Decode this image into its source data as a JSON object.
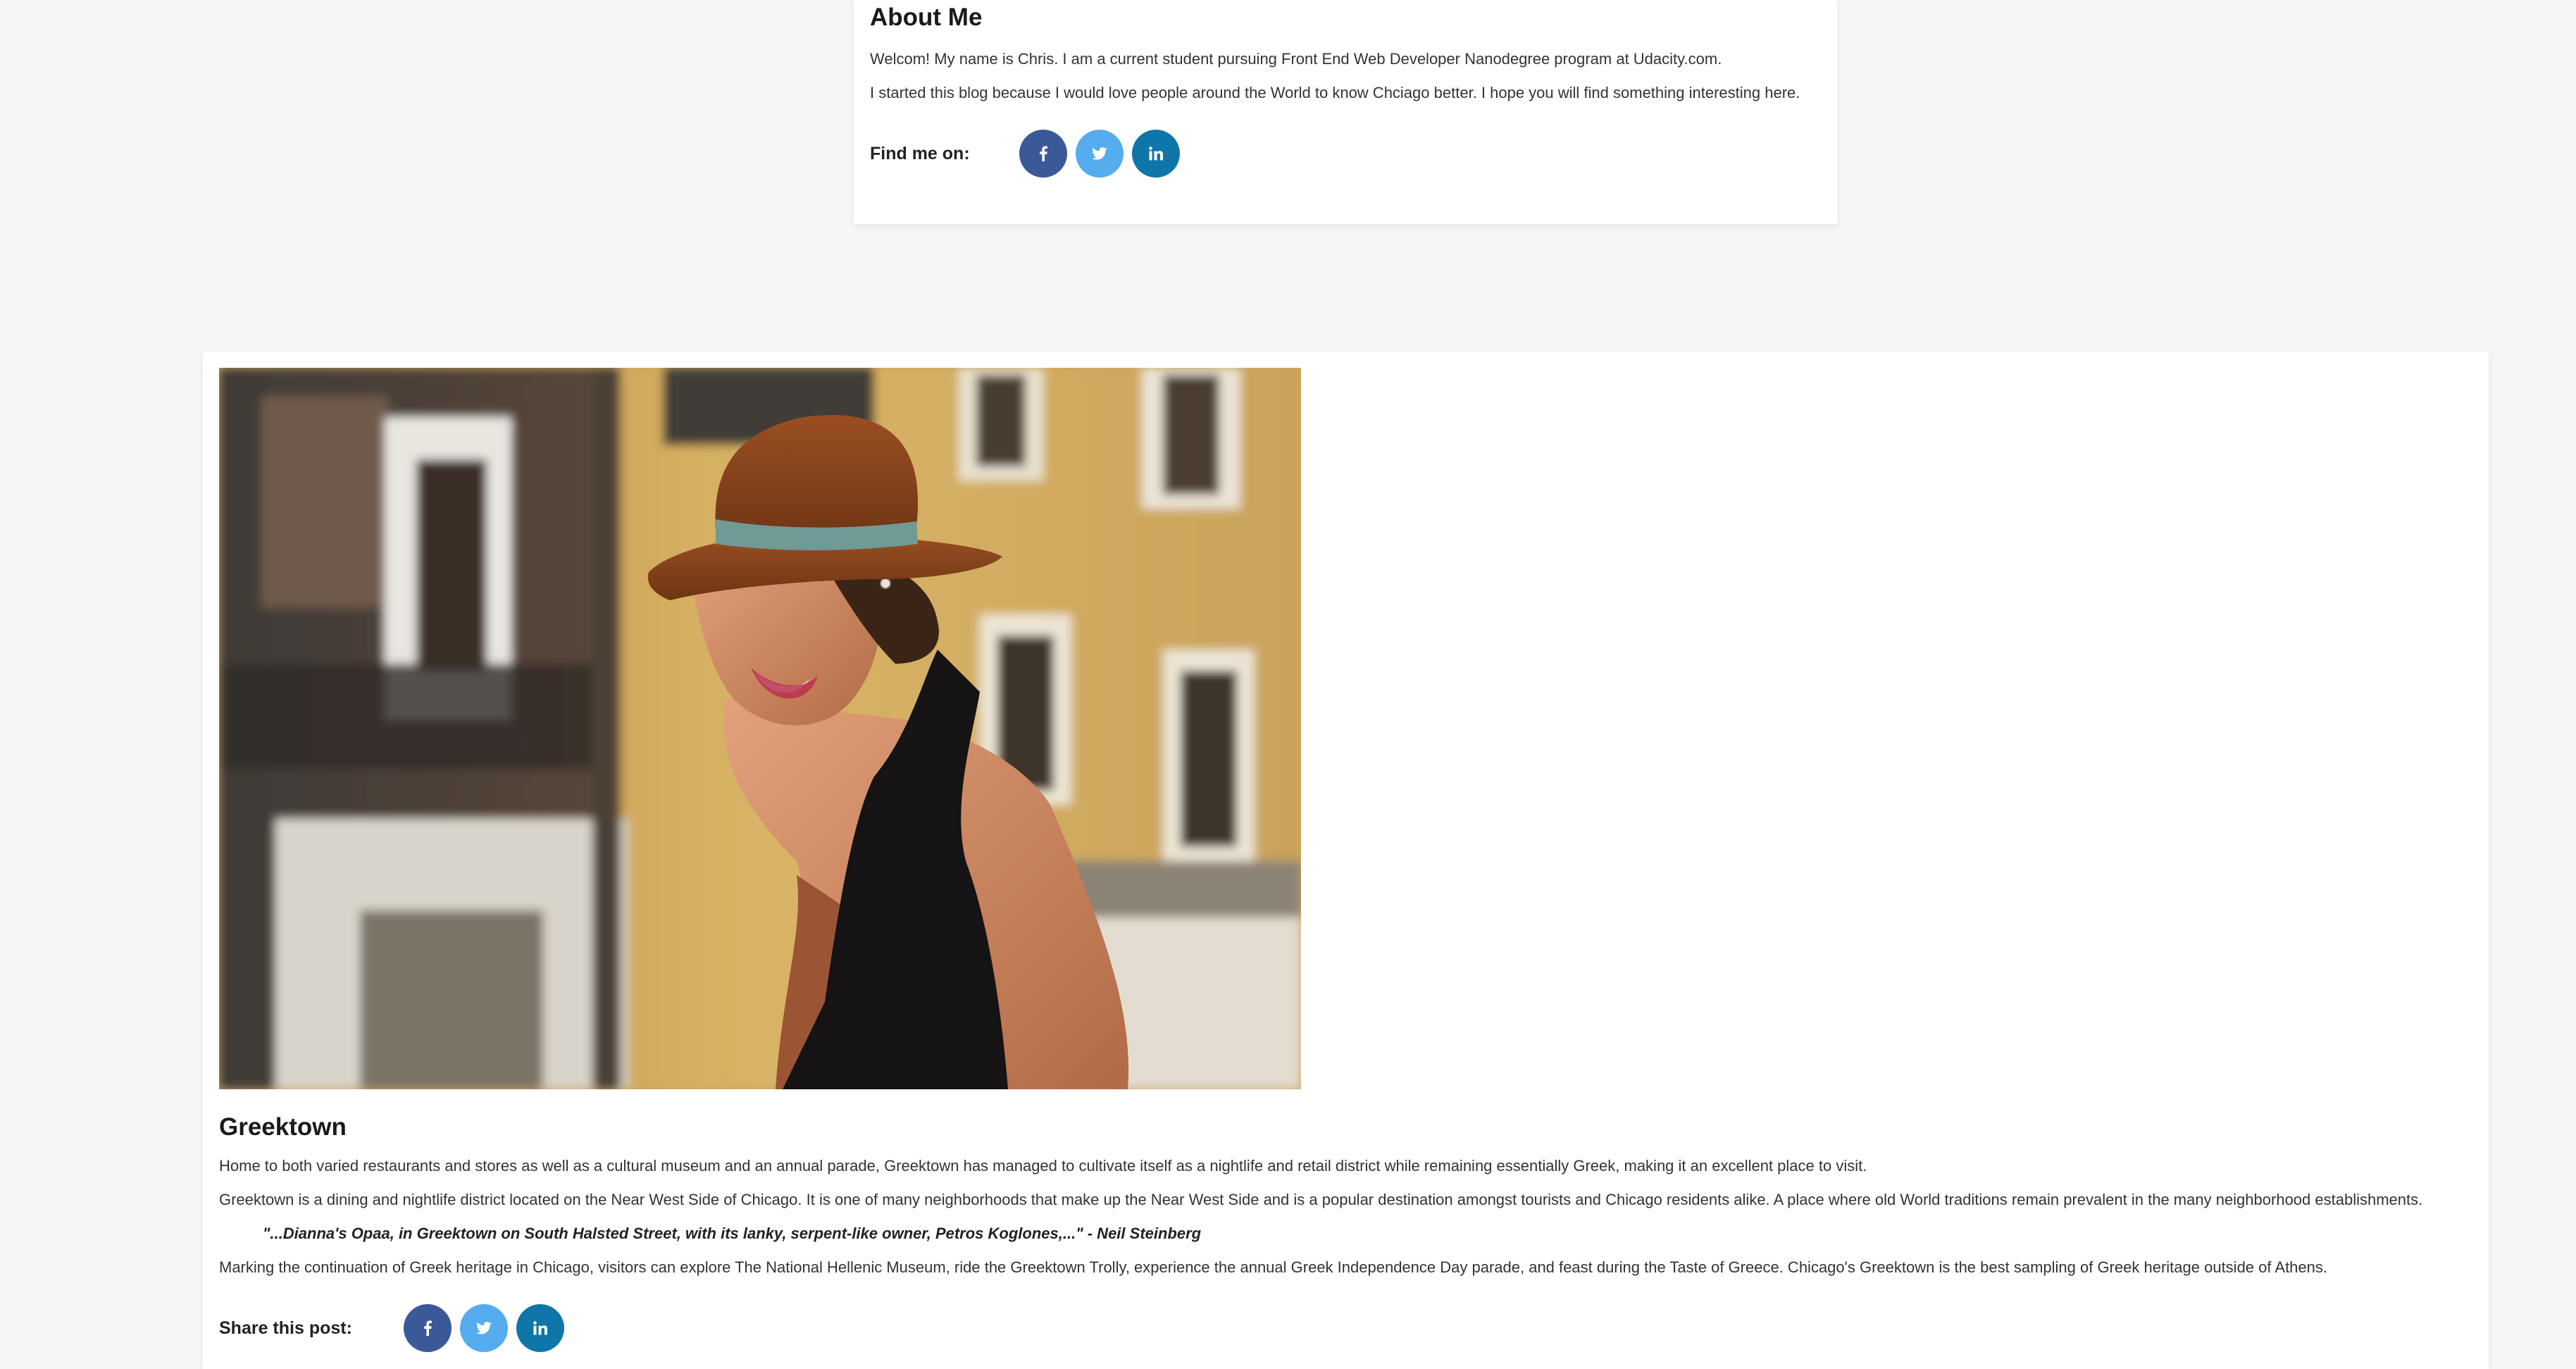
{
  "about": {
    "title": "About Me",
    "paragraph1": "Welcom! My name is Chris. I am a current student pursuing Front End Web Developer Nanodegree program at Udacity.com.",
    "paragraph2": "I started this blog because I would love people around the World to know Chciago better. I hope you will find something interesting here.",
    "find_me_label": "Find me on:",
    "social": [
      {
        "network": "facebook",
        "icon": "facebook-icon",
        "glyph": "f",
        "color": "#3b5998"
      },
      {
        "network": "twitter",
        "icon": "twitter-icon",
        "glyph": "bird",
        "color": "#55acee"
      },
      {
        "network": "linkedin",
        "icon": "linkedin-icon",
        "glyph": "in",
        "color": "#0e76a8"
      }
    ]
  },
  "post": {
    "image": {
      "subject": "woman in rust-colored fedora and black backless dress in front of yellow building"
    },
    "title": "Greektown",
    "paragraph1": "Home to both varied restaurants and stores as well as a cultural museum and an annual parade, Greektown has managed to cultivate itself as a nightlife and retail district while remaining essentially Greek, making it an excellent place to visit.",
    "paragraph2": "Greektown is a dining and nightlife district located on the Near West Side of Chicago. It is one of many neighborhoods that make up the Near West Side and is a popular destination amongst tourists and Chicago residents alike. A place where old World traditions remain prevalent in the many neighborhood establishments.",
    "quote": "\"...Dianna's Opaa, in Greektown on South Halsted Street, with its lanky, serpent-like owner, Petros Koglones,...\" - Neil Steinberg",
    "paragraph3": "Marking the continuation of Greek heritage in Chicago, visitors can explore The National Hellenic Museum, ride the Greektown Trolly, experience the annual Greek Independence Day parade, and feast during the Taste of Greece. Chicago's Greektown is the best sampling of Greek heritage outside of Athens.",
    "share_label": "Share this post:"
  },
  "colors": {
    "page_background": "#f6f6f6",
    "card_background": "#ffffff",
    "facebook": "#3b5998",
    "twitter": "#55acee",
    "linkedin": "#0e76a8"
  }
}
